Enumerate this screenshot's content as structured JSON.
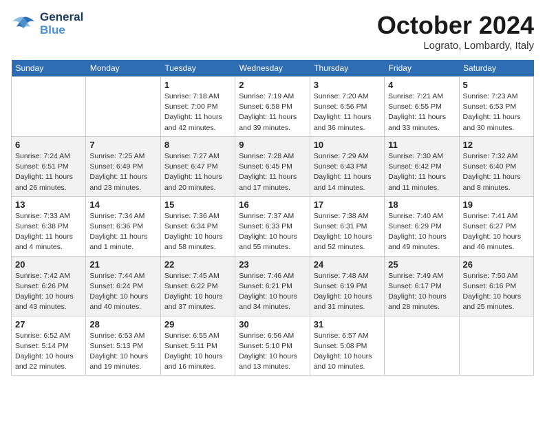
{
  "header": {
    "logo_line1": "General",
    "logo_line2": "Blue",
    "month": "October 2024",
    "location": "Lograto, Lombardy, Italy"
  },
  "weekdays": [
    "Sunday",
    "Monday",
    "Tuesday",
    "Wednesday",
    "Thursday",
    "Friday",
    "Saturday"
  ],
  "weeks": [
    [
      {
        "day": "",
        "info": ""
      },
      {
        "day": "",
        "info": ""
      },
      {
        "day": "1",
        "info": "Sunrise: 7:18 AM\nSunset: 7:00 PM\nDaylight: 11 hours\nand 42 minutes."
      },
      {
        "day": "2",
        "info": "Sunrise: 7:19 AM\nSunset: 6:58 PM\nDaylight: 11 hours\nand 39 minutes."
      },
      {
        "day": "3",
        "info": "Sunrise: 7:20 AM\nSunset: 6:56 PM\nDaylight: 11 hours\nand 36 minutes."
      },
      {
        "day": "4",
        "info": "Sunrise: 7:21 AM\nSunset: 6:55 PM\nDaylight: 11 hours\nand 33 minutes."
      },
      {
        "day": "5",
        "info": "Sunrise: 7:23 AM\nSunset: 6:53 PM\nDaylight: 11 hours\nand 30 minutes."
      }
    ],
    [
      {
        "day": "6",
        "info": "Sunrise: 7:24 AM\nSunset: 6:51 PM\nDaylight: 11 hours\nand 26 minutes."
      },
      {
        "day": "7",
        "info": "Sunrise: 7:25 AM\nSunset: 6:49 PM\nDaylight: 11 hours\nand 23 minutes."
      },
      {
        "day": "8",
        "info": "Sunrise: 7:27 AM\nSunset: 6:47 PM\nDaylight: 11 hours\nand 20 minutes."
      },
      {
        "day": "9",
        "info": "Sunrise: 7:28 AM\nSunset: 6:45 PM\nDaylight: 11 hours\nand 17 minutes."
      },
      {
        "day": "10",
        "info": "Sunrise: 7:29 AM\nSunset: 6:43 PM\nDaylight: 11 hours\nand 14 minutes."
      },
      {
        "day": "11",
        "info": "Sunrise: 7:30 AM\nSunset: 6:42 PM\nDaylight: 11 hours\nand 11 minutes."
      },
      {
        "day": "12",
        "info": "Sunrise: 7:32 AM\nSunset: 6:40 PM\nDaylight: 11 hours\nand 8 minutes."
      }
    ],
    [
      {
        "day": "13",
        "info": "Sunrise: 7:33 AM\nSunset: 6:38 PM\nDaylight: 11 hours\nand 4 minutes."
      },
      {
        "day": "14",
        "info": "Sunrise: 7:34 AM\nSunset: 6:36 PM\nDaylight: 11 hours\nand 1 minute."
      },
      {
        "day": "15",
        "info": "Sunrise: 7:36 AM\nSunset: 6:34 PM\nDaylight: 10 hours\nand 58 minutes."
      },
      {
        "day": "16",
        "info": "Sunrise: 7:37 AM\nSunset: 6:33 PM\nDaylight: 10 hours\nand 55 minutes."
      },
      {
        "day": "17",
        "info": "Sunrise: 7:38 AM\nSunset: 6:31 PM\nDaylight: 10 hours\nand 52 minutes."
      },
      {
        "day": "18",
        "info": "Sunrise: 7:40 AM\nSunset: 6:29 PM\nDaylight: 10 hours\nand 49 minutes."
      },
      {
        "day": "19",
        "info": "Sunrise: 7:41 AM\nSunset: 6:27 PM\nDaylight: 10 hours\nand 46 minutes."
      }
    ],
    [
      {
        "day": "20",
        "info": "Sunrise: 7:42 AM\nSunset: 6:26 PM\nDaylight: 10 hours\nand 43 minutes."
      },
      {
        "day": "21",
        "info": "Sunrise: 7:44 AM\nSunset: 6:24 PM\nDaylight: 10 hours\nand 40 minutes."
      },
      {
        "day": "22",
        "info": "Sunrise: 7:45 AM\nSunset: 6:22 PM\nDaylight: 10 hours\nand 37 minutes."
      },
      {
        "day": "23",
        "info": "Sunrise: 7:46 AM\nSunset: 6:21 PM\nDaylight: 10 hours\nand 34 minutes."
      },
      {
        "day": "24",
        "info": "Sunrise: 7:48 AM\nSunset: 6:19 PM\nDaylight: 10 hours\nand 31 minutes."
      },
      {
        "day": "25",
        "info": "Sunrise: 7:49 AM\nSunset: 6:17 PM\nDaylight: 10 hours\nand 28 minutes."
      },
      {
        "day": "26",
        "info": "Sunrise: 7:50 AM\nSunset: 6:16 PM\nDaylight: 10 hours\nand 25 minutes."
      }
    ],
    [
      {
        "day": "27",
        "info": "Sunrise: 6:52 AM\nSunset: 5:14 PM\nDaylight: 10 hours\nand 22 minutes."
      },
      {
        "day": "28",
        "info": "Sunrise: 6:53 AM\nSunset: 5:13 PM\nDaylight: 10 hours\nand 19 minutes."
      },
      {
        "day": "29",
        "info": "Sunrise: 6:55 AM\nSunset: 5:11 PM\nDaylight: 10 hours\nand 16 minutes."
      },
      {
        "day": "30",
        "info": "Sunrise: 6:56 AM\nSunset: 5:10 PM\nDaylight: 10 hours\nand 13 minutes."
      },
      {
        "day": "31",
        "info": "Sunrise: 6:57 AM\nSunset: 5:08 PM\nDaylight: 10 hours\nand 10 minutes."
      },
      {
        "day": "",
        "info": ""
      },
      {
        "day": "",
        "info": ""
      }
    ]
  ]
}
